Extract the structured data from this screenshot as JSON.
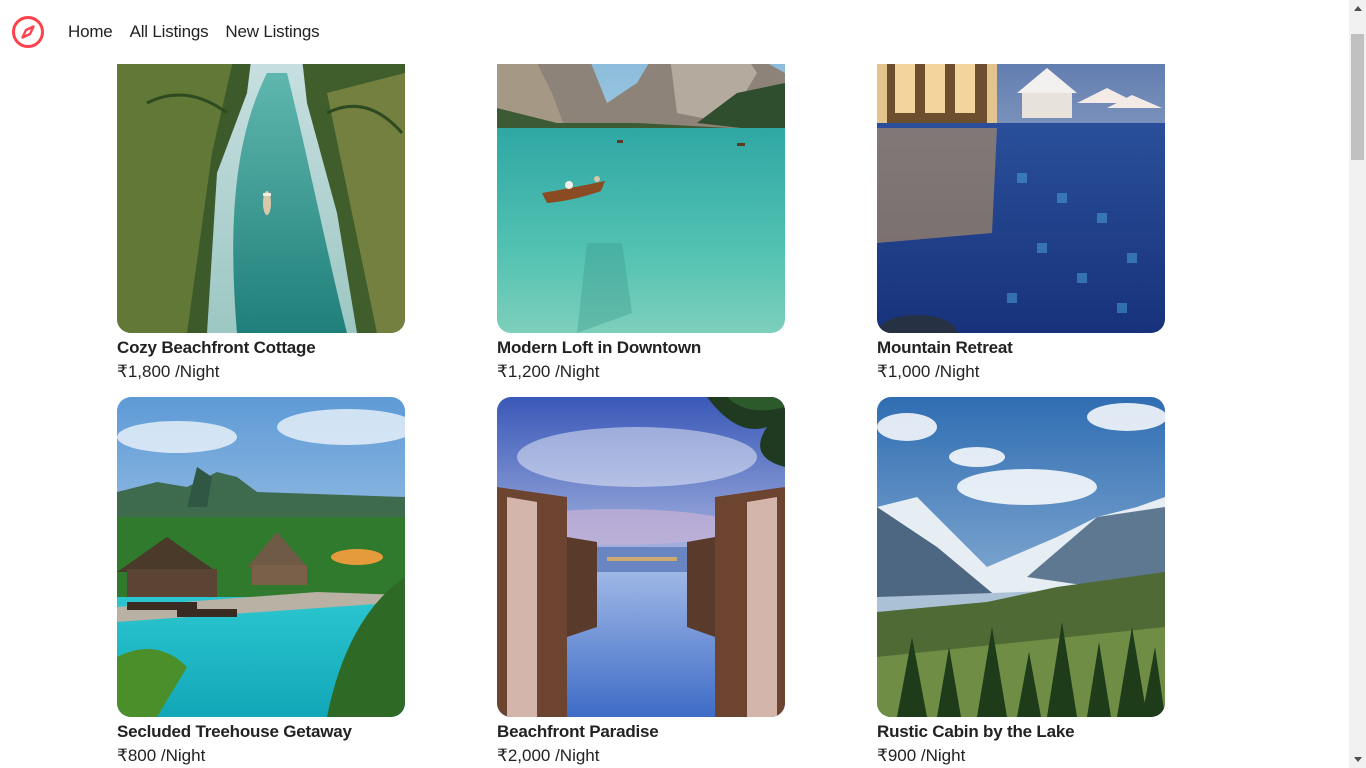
{
  "nav": {
    "links": [
      {
        "label": "Home"
      },
      {
        "label": "All Listings"
      },
      {
        "label": "New Listings"
      }
    ],
    "brand_color": "#fe424d",
    "logo_icon": "compass-icon"
  },
  "listings": [
    {
      "title": "Cozy Beachfront Cottage",
      "price": "₹1,800 /Night",
      "image": "tropical-river-with-palms"
    },
    {
      "title": "Modern Loft in Downtown",
      "price": "₹1,200 /Night",
      "image": "mountain-lake-with-boat"
    },
    {
      "title": "Mountain Retreat",
      "price": "₹1,000 /Night",
      "image": "resort-pool-at-dusk"
    },
    {
      "title": "Secluded Treehouse Getaway",
      "price": "₹800 /Night",
      "image": "jungle-resort-pool"
    },
    {
      "title": "Beachfront Paradise",
      "price": "₹2,000 /Night",
      "image": "infinity-pool-cabanas"
    },
    {
      "title": "Rustic Cabin by the Lake",
      "price": "₹900 /Night",
      "image": "mountain-valley-forest"
    }
  ]
}
